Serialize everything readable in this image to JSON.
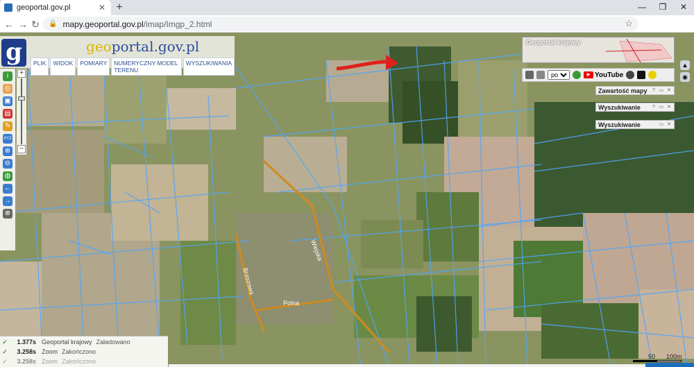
{
  "browser": {
    "tab_title": "geoportal.gov.pl",
    "url_host": "mapy.geoportal.gov.pl",
    "url_path": "/imap/Imgp_2.html"
  },
  "app": {
    "logo_prefix": "g",
    "logo_text_geo": "eo",
    "logo_text_portal": "portal.gov.pl",
    "menu": [
      "PLIK",
      "WIDOK",
      "POMIARY",
      "NUMERYCZNY MODEL TERENU",
      "WYSZUKIWANIA"
    ]
  },
  "minimap": {
    "title": "Geoportal krajowy"
  },
  "toolbar": {
    "language": "pol",
    "youtube_label": "YouTube"
  },
  "panels": [
    {
      "title": "Zawartość mapy"
    },
    {
      "title": "Wyszukiwanie"
    },
    {
      "title": "Wyszukiwanie"
    }
  ],
  "street_labels": [
    "Wiejska",
    "Brzozowa",
    "Polna"
  ],
  "status": [
    {
      "time": "1.377s",
      "name": "Geoportal krajowy",
      "state": "Załadowano"
    },
    {
      "time": "3.258s",
      "name": "Zoom",
      "state": "Zakończono"
    },
    {
      "time": "3.258s",
      "name": "Zoom",
      "state": "Zakończono"
    }
  ],
  "scale": {
    "left": "50",
    "right": "100m"
  },
  "colors": {
    "parcel_lines": "#4da6ff",
    "road": "#d08a1f",
    "arrow": "#e0201c",
    "logo_blue": "#1f3d8a"
  }
}
